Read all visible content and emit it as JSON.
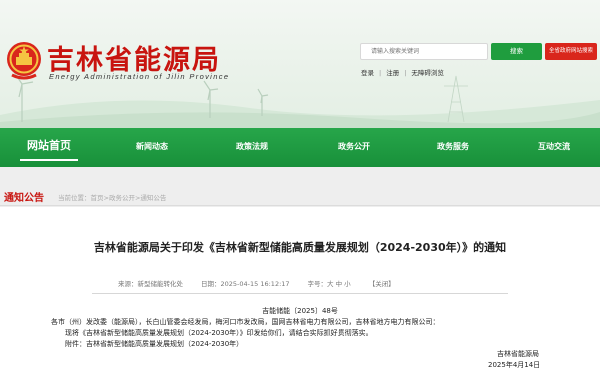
{
  "header": {
    "site_title": "吉林省能源局",
    "site_subtitle": "Energy Administration of Jilin Province",
    "search_placeholder": "请输入搜索关键词",
    "search_button": "搜索",
    "advanced_search": "全省政府网站搜索",
    "links": [
      "登录",
      "注册",
      "无障碍浏览"
    ]
  },
  "nav": {
    "items": [
      "网站首页",
      "新闻动态",
      "政策法规",
      "政务公开",
      "政务服务",
      "互动交流"
    ],
    "active": "网站首页"
  },
  "section": {
    "title": "通知公告",
    "breadcrumb": "当前位置：首页>政务公开>通知公告"
  },
  "article": {
    "title": "吉林省能源局关于印发《吉林省新型储能高质量发展规划（2024-2030年）》的通知",
    "meta": {
      "source": "来源：新型储能转化处",
      "date": "日期：2025-04-15 16:12:17",
      "font_size": "字号：大 中 小",
      "close": "【关闭】"
    },
    "doc_number": "吉能储能〔2025〕48号",
    "lines": [
      "各市（州）发改委（能源局），长白山管委会经发局，梅河口市发改局，国网吉林省电力有限公司，吉林省地方电力有限公司：",
      "现将《吉林省新型储能高质量发展规划（2024-2030年）》印发给你们，请结合实际抓好贯彻落实。",
      "附件：吉林省新型储能高质量发展规划（2024-2030年）"
    ],
    "signature": "吉林省能源局",
    "sign_date": "2025年4月14日"
  },
  "colors": {
    "brand_red": "#c8140f",
    "nav_green": "#1f9d3e",
    "band_gray": "#eeeeee"
  }
}
